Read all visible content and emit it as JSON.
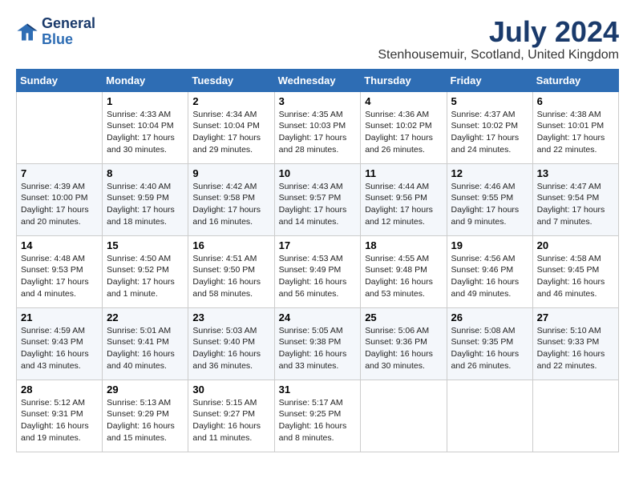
{
  "header": {
    "logo_line1": "General",
    "logo_line2": "Blue",
    "month": "July 2024",
    "location": "Stenhousemuir, Scotland, United Kingdom"
  },
  "weekdays": [
    "Sunday",
    "Monday",
    "Tuesday",
    "Wednesday",
    "Thursday",
    "Friday",
    "Saturday"
  ],
  "weeks": [
    [
      {
        "day": "",
        "info": ""
      },
      {
        "day": "1",
        "info": "Sunrise: 4:33 AM\nSunset: 10:04 PM\nDaylight: 17 hours\nand 30 minutes."
      },
      {
        "day": "2",
        "info": "Sunrise: 4:34 AM\nSunset: 10:04 PM\nDaylight: 17 hours\nand 29 minutes."
      },
      {
        "day": "3",
        "info": "Sunrise: 4:35 AM\nSunset: 10:03 PM\nDaylight: 17 hours\nand 28 minutes."
      },
      {
        "day": "4",
        "info": "Sunrise: 4:36 AM\nSunset: 10:02 PM\nDaylight: 17 hours\nand 26 minutes."
      },
      {
        "day": "5",
        "info": "Sunrise: 4:37 AM\nSunset: 10:02 PM\nDaylight: 17 hours\nand 24 minutes."
      },
      {
        "day": "6",
        "info": "Sunrise: 4:38 AM\nSunset: 10:01 PM\nDaylight: 17 hours\nand 22 minutes."
      }
    ],
    [
      {
        "day": "7",
        "info": "Sunrise: 4:39 AM\nSunset: 10:00 PM\nDaylight: 17 hours\nand 20 minutes."
      },
      {
        "day": "8",
        "info": "Sunrise: 4:40 AM\nSunset: 9:59 PM\nDaylight: 17 hours\nand 18 minutes."
      },
      {
        "day": "9",
        "info": "Sunrise: 4:42 AM\nSunset: 9:58 PM\nDaylight: 17 hours\nand 16 minutes."
      },
      {
        "day": "10",
        "info": "Sunrise: 4:43 AM\nSunset: 9:57 PM\nDaylight: 17 hours\nand 14 minutes."
      },
      {
        "day": "11",
        "info": "Sunrise: 4:44 AM\nSunset: 9:56 PM\nDaylight: 17 hours\nand 12 minutes."
      },
      {
        "day": "12",
        "info": "Sunrise: 4:46 AM\nSunset: 9:55 PM\nDaylight: 17 hours\nand 9 minutes."
      },
      {
        "day": "13",
        "info": "Sunrise: 4:47 AM\nSunset: 9:54 PM\nDaylight: 17 hours\nand 7 minutes."
      }
    ],
    [
      {
        "day": "14",
        "info": "Sunrise: 4:48 AM\nSunset: 9:53 PM\nDaylight: 17 hours\nand 4 minutes."
      },
      {
        "day": "15",
        "info": "Sunrise: 4:50 AM\nSunset: 9:52 PM\nDaylight: 17 hours\nand 1 minute."
      },
      {
        "day": "16",
        "info": "Sunrise: 4:51 AM\nSunset: 9:50 PM\nDaylight: 16 hours\nand 58 minutes."
      },
      {
        "day": "17",
        "info": "Sunrise: 4:53 AM\nSunset: 9:49 PM\nDaylight: 16 hours\nand 56 minutes."
      },
      {
        "day": "18",
        "info": "Sunrise: 4:55 AM\nSunset: 9:48 PM\nDaylight: 16 hours\nand 53 minutes."
      },
      {
        "day": "19",
        "info": "Sunrise: 4:56 AM\nSunset: 9:46 PM\nDaylight: 16 hours\nand 49 minutes."
      },
      {
        "day": "20",
        "info": "Sunrise: 4:58 AM\nSunset: 9:45 PM\nDaylight: 16 hours\nand 46 minutes."
      }
    ],
    [
      {
        "day": "21",
        "info": "Sunrise: 4:59 AM\nSunset: 9:43 PM\nDaylight: 16 hours\nand 43 minutes."
      },
      {
        "day": "22",
        "info": "Sunrise: 5:01 AM\nSunset: 9:41 PM\nDaylight: 16 hours\nand 40 minutes."
      },
      {
        "day": "23",
        "info": "Sunrise: 5:03 AM\nSunset: 9:40 PM\nDaylight: 16 hours\nand 36 minutes."
      },
      {
        "day": "24",
        "info": "Sunrise: 5:05 AM\nSunset: 9:38 PM\nDaylight: 16 hours\nand 33 minutes."
      },
      {
        "day": "25",
        "info": "Sunrise: 5:06 AM\nSunset: 9:36 PM\nDaylight: 16 hours\nand 30 minutes."
      },
      {
        "day": "26",
        "info": "Sunrise: 5:08 AM\nSunset: 9:35 PM\nDaylight: 16 hours\nand 26 minutes."
      },
      {
        "day": "27",
        "info": "Sunrise: 5:10 AM\nSunset: 9:33 PM\nDaylight: 16 hours\nand 22 minutes."
      }
    ],
    [
      {
        "day": "28",
        "info": "Sunrise: 5:12 AM\nSunset: 9:31 PM\nDaylight: 16 hours\nand 19 minutes."
      },
      {
        "day": "29",
        "info": "Sunrise: 5:13 AM\nSunset: 9:29 PM\nDaylight: 16 hours\nand 15 minutes."
      },
      {
        "day": "30",
        "info": "Sunrise: 5:15 AM\nSunset: 9:27 PM\nDaylight: 16 hours\nand 11 minutes."
      },
      {
        "day": "31",
        "info": "Sunrise: 5:17 AM\nSunset: 9:25 PM\nDaylight: 16 hours\nand 8 minutes."
      },
      {
        "day": "",
        "info": ""
      },
      {
        "day": "",
        "info": ""
      },
      {
        "day": "",
        "info": ""
      }
    ]
  ]
}
